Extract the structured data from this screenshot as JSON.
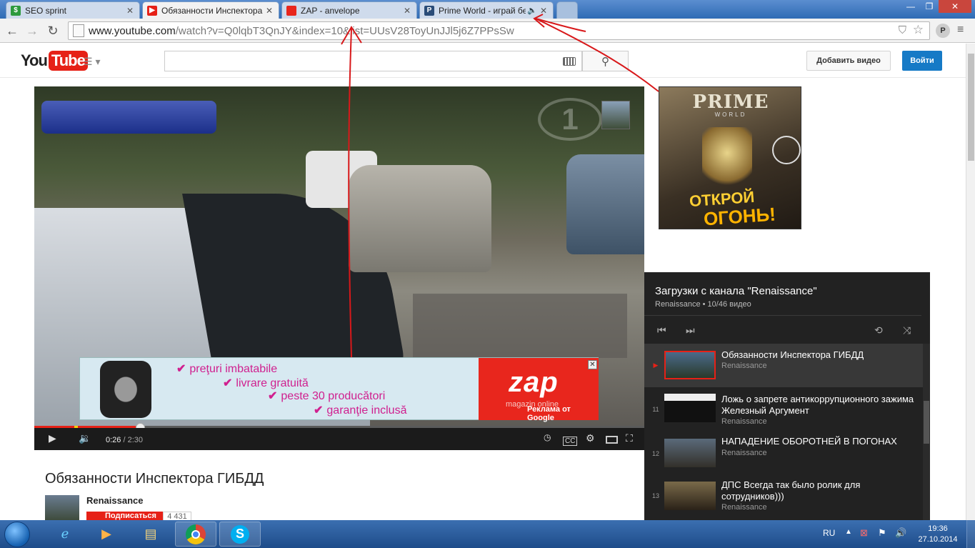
{
  "browser": {
    "tabs": [
      {
        "title": "SEO sprint",
        "favicon": "seosprint-icon",
        "color": "#2d9a3e",
        "active": false
      },
      {
        "title": "Обязанности Инспектора",
        "favicon": "youtube-icon",
        "color": "#e62117",
        "active": true
      },
      {
        "title": "ZAP - anvelope",
        "favicon": "zap-icon",
        "color": "#e8261d",
        "active": false
      },
      {
        "title": "Prime World - играй бе",
        "favicon": "primeworld-icon",
        "color": "#2a4c78",
        "active": false,
        "audio": "speaker-icon"
      }
    ],
    "url_host": "www.youtube.com",
    "url_path": "/watch?v=Q0lqbT3QnJY&index=10&list=UUsV28ToyUnJJl5j6Z7PPsSw",
    "user_initial": "P"
  },
  "youtube": {
    "logo_you": "You",
    "logo_tube": "Tube",
    "search_placeholder": "",
    "upload_label": "Добавить видео",
    "signin_label": "Войти"
  },
  "player": {
    "current_time": "0:26",
    "duration": " / 2:30",
    "progress_fraction": 0.173,
    "ad": {
      "lines": [
        "preţuri imbatabile",
        "livrare gratuită",
        "peste 30 producători",
        "garanţie inclusă"
      ],
      "logo": "zap",
      "sub": "magazin online",
      "google": "Реклама от Google"
    }
  },
  "side_ad": {
    "brand": "PRIME",
    "sub": "WORLD",
    "cta1": "ОТКРОЙ",
    "cta2": "ОГОНЬ!"
  },
  "playlist": {
    "title": "Загрузки с канала \"Renaissance\"",
    "meta": "Renaissance • 10/46 видео",
    "items": [
      {
        "index": "▶",
        "title": "Обязанности Инспектора ГИБДД",
        "channel": "Renaissance",
        "current": true
      },
      {
        "index": "11",
        "title": "Ложь о запрете антикоррупционного зажима Железный Аргумент",
        "channel": "Renaissance",
        "current": false
      },
      {
        "index": "12",
        "title": "НАПАДЕНИЕ ОБОРОТНЕЙ В ПОГОНАХ",
        "channel": "Renaissance",
        "current": false
      },
      {
        "index": "13",
        "title": "ДПС Всегда так было ролик для сотрудников)))",
        "channel": "Renaissance",
        "current": false
      }
    ]
  },
  "video": {
    "title": "Обязанности Инспектора ГИБДД",
    "channel": "Renaissance",
    "subscribe_label": "Подписаться",
    "subscriber_count": "4 431"
  },
  "taskbar": {
    "lang": "RU",
    "time": "19:36",
    "date": "27.10.2014"
  }
}
